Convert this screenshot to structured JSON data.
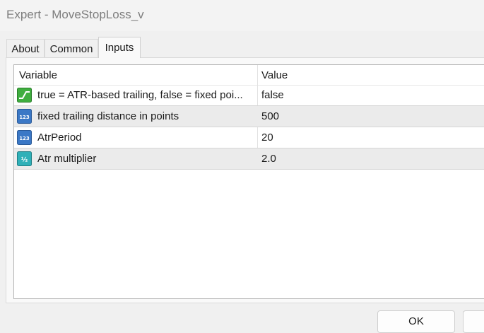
{
  "window": {
    "title": "Expert - MoveStopLoss_v"
  },
  "tabs": [
    {
      "label": "About"
    },
    {
      "label": "Common"
    },
    {
      "label": "Inputs"
    }
  ],
  "table": {
    "headers": {
      "variable": "Variable",
      "value": "Value"
    },
    "rows": [
      {
        "icon": "bool-icon",
        "variable": "true = ATR-based trailing, false = fixed poi...",
        "value": "false"
      },
      {
        "icon": "int-icon",
        "variable": "fixed trailing distance in points",
        "value": "500"
      },
      {
        "icon": "int-icon",
        "variable": "AtrPeriod",
        "value": "20"
      },
      {
        "icon": "double-icon",
        "variable": "Atr multiplier",
        "value": "2.0"
      }
    ]
  },
  "buttons": {
    "ok": "OK",
    "cancel": ""
  },
  "colors": {
    "bool_icon": "#3fae3f",
    "int_icon": "#3b78c6",
    "double_icon": "#2fb0b8"
  }
}
